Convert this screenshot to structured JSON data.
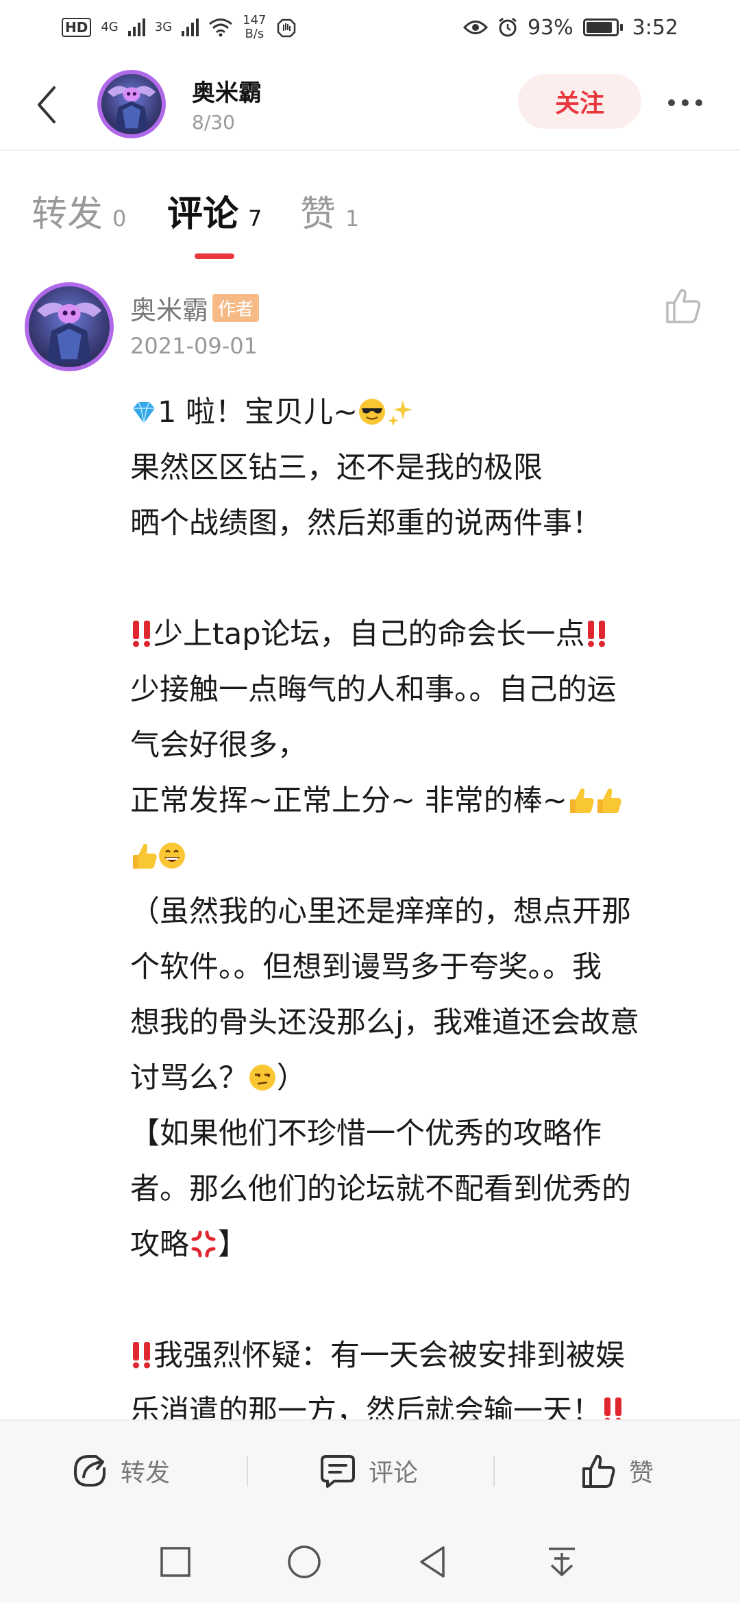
{
  "status_bar": {
    "left_labels": [
      "HD",
      "4G",
      "3G"
    ],
    "net_speed_value": "147",
    "net_speed_unit": "B/s",
    "battery": "93%",
    "time": "3:52"
  },
  "header": {
    "name": "奥米霸",
    "subtitle": "8/30",
    "follow_label": "关注"
  },
  "tabs": [
    {
      "label": "转发",
      "count": "0"
    },
    {
      "label": "评论",
      "count": "7"
    },
    {
      "label": "赞",
      "count": "1"
    }
  ],
  "comment": {
    "author": "奥米霸",
    "badge": "作者",
    "date": "2021-09-01",
    "lines": [
      "1 啦！宝贝儿~",
      "果然区区钻三，还不是我的极限",
      "晒个战绩图，然后郑重的说两件事！",
      "",
      "少上tap论坛，自己的命会长一点",
      "少接触一点晦气的人和事。。自己的运",
      "气会好很多，",
      "正常发挥~正常上分~  非常的棒~",
      "",
      "（虽然我的心里还是痒痒的，想点开那",
      "个软件。。但想到谩骂多于夸奖。。我",
      "想我的骨头还没那么j，我难道还会故意",
      "讨骂么？",
      "【如果他们不珍惜一个优秀的攻略作",
      "者。那么他们的论坛就不配看到优秀的",
      "攻略",
      "",
      "我强烈怀疑：有一天会被安排到被娱",
      "乐消遣的那一方，然后就会输一天！"
    ],
    "line_suffixes": [
      "",
      "",
      "",
      "",
      "",
      "",
      "",
      "",
      "",
      "",
      "",
      "",
      "）",
      "",
      "",
      "】",
      "",
      "",
      ""
    ]
  },
  "action_bar": {
    "repost": "转发",
    "comment": "评论",
    "like": "赞"
  },
  "colors": {
    "accent": "#e8373e",
    "badge": "#f5ba86",
    "avatar_ring": "#b069e8"
  }
}
